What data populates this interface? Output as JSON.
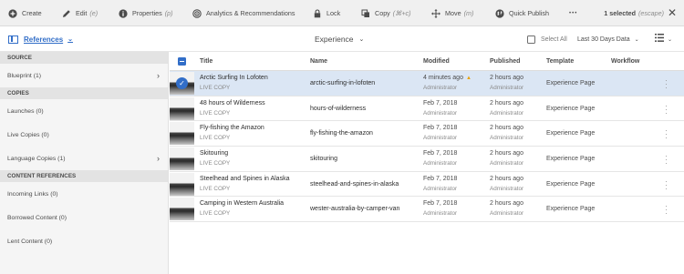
{
  "toolbar": {
    "create": "Create",
    "edit": "Edit",
    "edit_shortcut": "(e)",
    "properties": "Properties",
    "properties_shortcut": "(p)",
    "analytics": "Analytics & Recommendations",
    "lock": "Lock",
    "copy": "Copy",
    "copy_shortcut": "(⌘+c)",
    "move": "Move",
    "move_shortcut": "(m)",
    "quick_publish": "Quick Publish",
    "more": "•••",
    "selected": "1 selected",
    "escape": "(escape)",
    "close": "✕"
  },
  "subbar": {
    "references": "References",
    "title": "Experience",
    "select_all": "Select All",
    "date_range": "Last 30 Days Data"
  },
  "rail": {
    "source_heading": "SOURCE",
    "blueprint": "Blueprint (1)",
    "copies_heading": "COPIES",
    "launches": "Launches (0)",
    "live_copies": "Live Copies (0)",
    "language_copies": "Language Copies (1)",
    "content_heading": "CONTENT REFERENCES",
    "incoming_links": "Incoming Links (0)",
    "borrowed_content": "Borrowed Content (0)",
    "lent_content": "Lent Content (0)"
  },
  "columns": {
    "title": "Title",
    "name": "Name",
    "modified": "Modified",
    "published": "Published",
    "template": "Template",
    "workflow": "Workflow"
  },
  "rows": [
    {
      "title": "Arctic Surfing In Lofoten",
      "sub": "LIVE COPY",
      "name": "arctic-surfing-in-lofoten",
      "modified": "4 minutes ago",
      "modified_by": "Administrator",
      "published": "2 hours ago",
      "published_by": "Administrator",
      "template": "Experience Page"
    },
    {
      "title": "48 hours of Wilderness",
      "sub": "LIVE COPY",
      "name": "hours-of-wilderness",
      "modified": "Feb 7, 2018",
      "modified_by": "Administrator",
      "published": "2 hours ago",
      "published_by": "Administrator",
      "template": "Experience Page"
    },
    {
      "title": "Fly-fishing the Amazon",
      "sub": "LIVE COPY",
      "name": "fly-fishing-the-amazon",
      "modified": "Feb 7, 2018",
      "modified_by": "Administrator",
      "published": "2 hours ago",
      "published_by": "Administrator",
      "template": "Experience Page"
    },
    {
      "title": "Skitouring",
      "sub": "LIVE COPY",
      "name": "skitouring",
      "modified": "Feb 7, 2018",
      "modified_by": "Administrator",
      "published": "2 hours ago",
      "published_by": "Administrator",
      "template": "Experience Page"
    },
    {
      "title": "Steelhead and Spines in Alaska",
      "sub": "LIVE COPY",
      "name": "steelhead-and-spines-in-alaska",
      "modified": "Feb 7, 2018",
      "modified_by": "Administrator",
      "published": "2 hours ago",
      "published_by": "Administrator",
      "template": "Experience Page"
    },
    {
      "title": "Camping in Western Australia",
      "sub": "LIVE COPY",
      "name": "wester-australia-by-camper-van",
      "modified": "Feb 7, 2018",
      "modified_by": "Administrator",
      "published": "2 hours ago",
      "published_by": "Administrator",
      "template": "Experience Page"
    }
  ],
  "colors": {
    "accent": "#326ec8",
    "selected_row": "#dbe6f4",
    "warning": "#e8a000"
  }
}
